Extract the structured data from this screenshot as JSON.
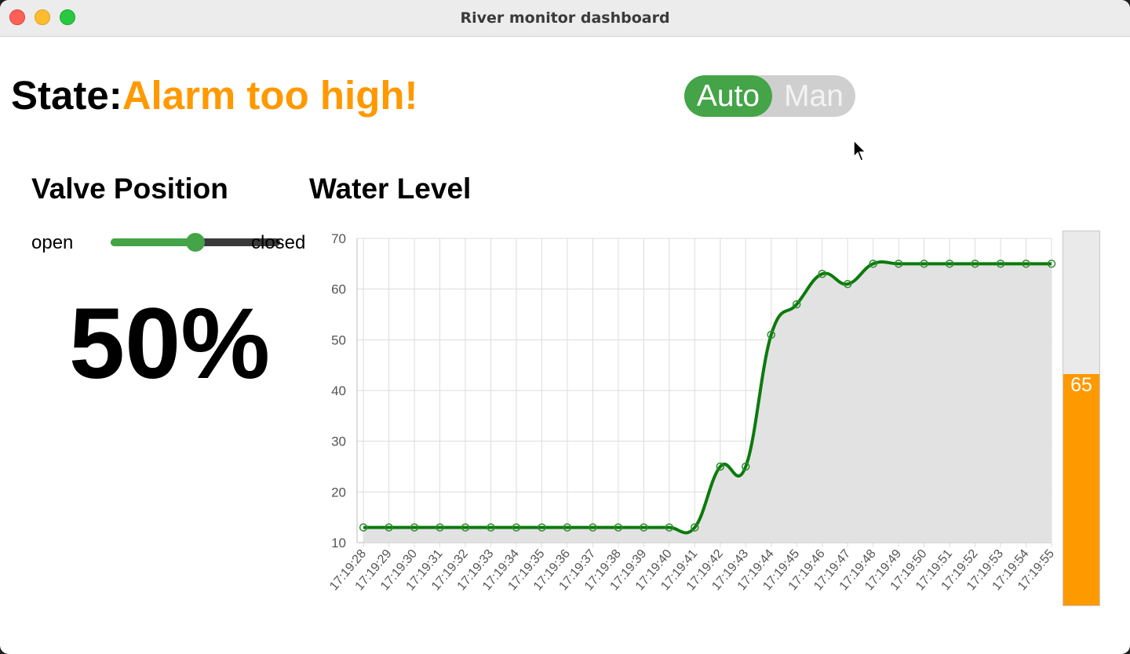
{
  "window": {
    "title": "River monitor dashboard"
  },
  "state": {
    "label": "State:",
    "value": "Alarm too high!",
    "value_color": "#ff9900"
  },
  "mode_toggle": {
    "options": [
      "Auto",
      "Man"
    ],
    "selected": "Auto",
    "active_color": "#44a447"
  },
  "valve": {
    "heading": "Valve Position",
    "open_label": "open",
    "closed_label": "closed",
    "position_fraction": 0.5,
    "percent_text": "50%"
  },
  "water_level": {
    "heading": "Water Level",
    "current_value": 65,
    "gauge_max": 70,
    "gauge_color": "#ff9900"
  },
  "chart_data": {
    "type": "area",
    "x": [
      "17:19:28",
      "17:19:29",
      "17:19:30",
      "17:19:31",
      "17:19:32",
      "17:19:33",
      "17:19:34",
      "17:19:35",
      "17:19:36",
      "17:19:37",
      "17:19:38",
      "17:19:39",
      "17:19:40",
      "17:19:41",
      "17:19:42",
      "17:19:43",
      "17:19:44",
      "17:19:45",
      "17:19:46",
      "17:19:47",
      "17:19:48",
      "17:19:49",
      "17:19:50",
      "17:19:51",
      "17:19:52",
      "17:19:53",
      "17:19:54",
      "17:19:55"
    ],
    "series": [
      {
        "values": [
          13,
          13,
          13,
          13,
          13,
          13,
          13,
          13,
          13,
          13,
          13,
          13,
          13,
          13,
          25,
          25,
          51,
          57,
          63,
          61,
          65,
          65,
          65,
          65,
          65,
          65,
          65,
          65
        ],
        "color": "#0b7a0b",
        "fill": "#e0e0e0"
      }
    ],
    "yticks": [
      10,
      20,
      30,
      40,
      50,
      60,
      70
    ],
    "ylim": [
      10,
      70
    ],
    "grid": true,
    "xlabel": "",
    "ylabel": ""
  }
}
